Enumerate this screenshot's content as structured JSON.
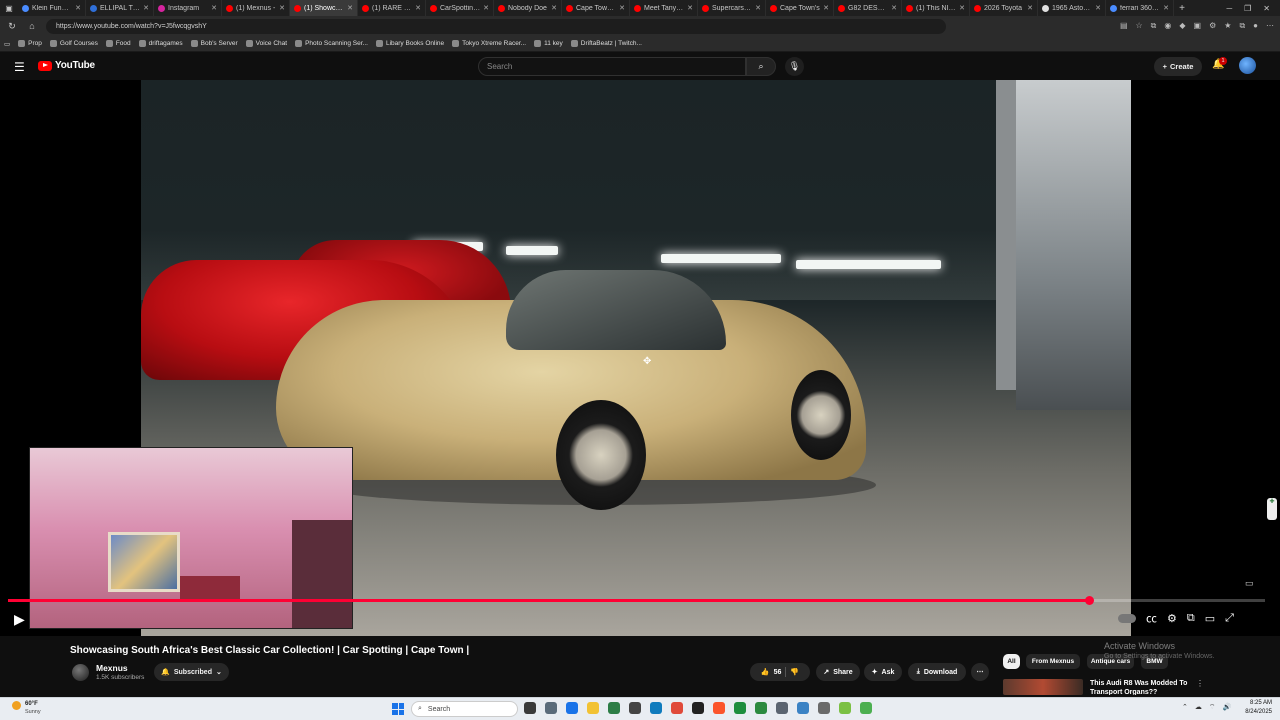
{
  "browser": {
    "tabs": [
      {
        "label": "Klein Funding",
        "color": "#4a8cff",
        "active": false
      },
      {
        "label": "ELLIPAL Titan",
        "color": "#2f6fd8",
        "active": false
      },
      {
        "label": "Instagram",
        "color": "#d6249f",
        "active": false
      },
      {
        "label": "(1) Mexnus -",
        "color": "#ff0000",
        "active": false
      },
      {
        "label": "(1) Showcasi",
        "color": "#ff0000",
        "active": true
      },
      {
        "label": "(1) RARE She",
        "color": "#ff0000",
        "active": false
      },
      {
        "label": "CarSpotting R",
        "color": "#ff0000",
        "active": false
      },
      {
        "label": "Nobody Doe",
        "color": "#ff0000",
        "active": false
      },
      {
        "label": "Cape Town Ca",
        "color": "#ff0000",
        "active": false
      },
      {
        "label": "Meet Tanya &",
        "color": "#ff0000",
        "active": false
      },
      {
        "label": "Supercars TAV",
        "color": "#ff0000",
        "active": false
      },
      {
        "label": "Cape Town's",
        "color": "#ff0000",
        "active": false
      },
      {
        "label": "G82 DESTRO",
        "color": "#ff0000",
        "active": false
      },
      {
        "label": "(1) This NIGH",
        "color": "#ff0000",
        "active": false
      },
      {
        "label": "2026 Toyota",
        "color": "#ff0000",
        "active": false
      },
      {
        "label": "1965 Aston M",
        "color": "#e0e0e0",
        "active": false
      },
      {
        "label": "ferrari 360 mo",
        "color": "#4a8cff",
        "active": false
      }
    ],
    "url": "https://www.youtube.com/watch?v=J5fwcqgvshY",
    "bookmarks": [
      "Prop",
      "Golf Courses",
      "Food",
      "driftagames",
      "Bob's Server",
      "Voice Chat",
      "Photo Scanning Ser...",
      "Libary Books Online",
      "Tokyo Xtreme Racer...",
      "11 key",
      "DriftaBeatz | Twitch..."
    ]
  },
  "youtube": {
    "logo_text": "YouTube",
    "search_placeholder": "Search",
    "create_label": "Create",
    "notification_count": "1"
  },
  "player": {
    "progress": 0.86,
    "is_paused": true
  },
  "video": {
    "title": "Showcasing South Africa's Best Classic Car Collection! | Car Spotting | Cape Town |",
    "channel_name": "Mexnus",
    "subscribers": "1.5K subscribers",
    "subscribed_label": "Subscribed",
    "likes": "56",
    "share_label": "Share",
    "ask_label": "Ask",
    "download_label": "Download"
  },
  "sidebar": {
    "chips": [
      "All",
      "From Mexnus",
      "Antique cars",
      "BMW"
    ],
    "active_chip": "All",
    "recommendation_title": "This Audi R8 Was Modded To Transport Organs??"
  },
  "watermark": {
    "line1": "Activate Windows",
    "line2": "Go to Settings to activate Windows."
  },
  "taskbar": {
    "weather_temp": "60°F",
    "weather_desc": "Sunny",
    "search_placeholder": "Search",
    "time": "8:25 AM",
    "date": "8/24/2025"
  }
}
